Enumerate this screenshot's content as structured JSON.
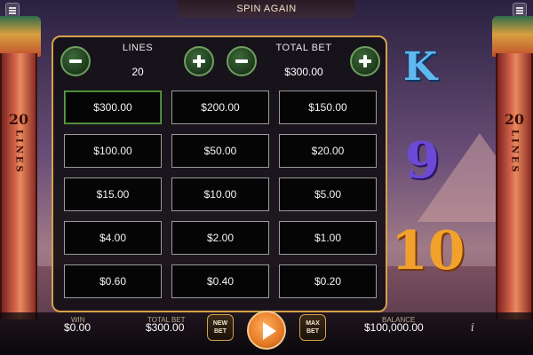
{
  "header": {
    "title": "SPIN AGAIN"
  },
  "icons": {
    "left_corner": "menu-icon",
    "right_corner": "menu-icon"
  },
  "pillars": {
    "left_number": "20",
    "left_label": "LINES",
    "right_number": "20",
    "right_label": "LINES"
  },
  "reel_symbols": [
    "K",
    "9",
    "10"
  ],
  "bet_panel": {
    "lines_title": "LINES",
    "lines_value": "20",
    "total_bet_title": "TOTAL BET",
    "total_bet_value": "$300.00",
    "selected_option": "$300.00",
    "options": [
      [
        "$300.00",
        "$200.00",
        "$150.00"
      ],
      [
        "$100.00",
        "$50.00",
        "$20.00"
      ],
      [
        "$15.00",
        "$10.00",
        "$5.00"
      ],
      [
        "$4.00",
        "$2.00",
        "$1.00"
      ],
      [
        "$0.60",
        "$0.40",
        "$0.20"
      ]
    ]
  },
  "bottom_bar": {
    "win_label": "WIN",
    "win_value": "$0.00",
    "total_bet_label": "TOTAL BET",
    "total_bet_value": "$300.00",
    "new_bet_label": "NEW BET",
    "max_bet_label": "MAX BET",
    "balance_label": "BALANCE",
    "balance_value": "$100,000.00",
    "info_label": "i"
  },
  "colors": {
    "panel_border": "#d6a14a",
    "selected_border": "#5fa046",
    "play_button": "#e67a24"
  }
}
